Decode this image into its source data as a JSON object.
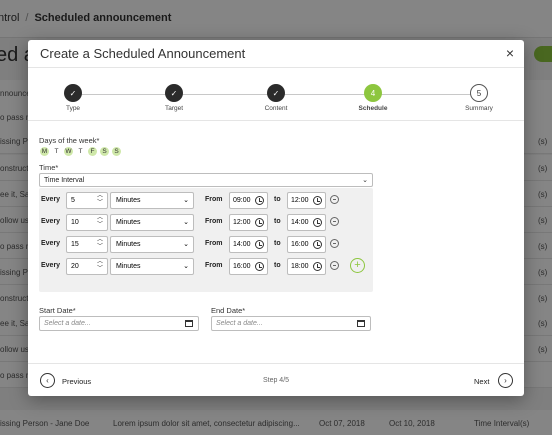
{
  "background": {
    "breadcrumb": [
      "ntrol",
      "/",
      "Scheduled announcement"
    ],
    "title": "ed a",
    "rows": [
      {
        "a": "nnounce",
        "b": "",
        "c": "",
        "d": "",
        "e": ""
      },
      {
        "a": "o pass m",
        "b": "",
        "c": "",
        "d": "",
        "e": ""
      },
      {
        "a": "issing Pe",
        "b": "",
        "c": "",
        "d": "",
        "e": "(s)"
      },
      {
        "a": "onstructi",
        "b": "",
        "c": "",
        "d": "",
        "e": "(s)"
      },
      {
        "a": "ee it, Say",
        "b": "",
        "c": "",
        "d": "",
        "e": "(s)"
      },
      {
        "a": "ollow us",
        "b": "",
        "c": "",
        "d": "",
        "e": "(s)"
      },
      {
        "a": "o pass m",
        "b": "",
        "c": "",
        "d": "",
        "e": "(s)"
      },
      {
        "a": "issing Pe",
        "b": "",
        "c": "",
        "d": "",
        "e": "(s)"
      },
      {
        "a": "onstructi",
        "b": "",
        "c": "",
        "d": "",
        "e": "(s)"
      },
      {
        "a": "ee it, Say",
        "b": "",
        "c": "",
        "d": "",
        "e": "(s)"
      },
      {
        "a": "ollow us",
        "b": "",
        "c": "",
        "d": "",
        "e": "(s)"
      },
      {
        "a": "o pass m",
        "b": "",
        "c": "",
        "d": "",
        "e": ""
      },
      {
        "a": "issing Person - Jane Doe",
        "b": "Lorem ipsum dolor sit amet, consectetur adipiscing...",
        "c": "Oct 07, 2018",
        "d": "Oct 10, 2018",
        "e": "Time Interval(s)"
      }
    ]
  },
  "modal": {
    "title": "Create a Scheduled Announcement",
    "close": "×",
    "steps": [
      {
        "label": "Type",
        "state": "done",
        "mark": "✓"
      },
      {
        "label": "Target",
        "state": "done",
        "mark": "✓"
      },
      {
        "label": "Content",
        "state": "done",
        "mark": "✓"
      },
      {
        "label": "Schedule",
        "state": "active",
        "mark": "4"
      },
      {
        "label": "Summary",
        "state": "todo",
        "mark": "5"
      }
    ],
    "days_label": "Days of the week*",
    "days": [
      {
        "letter": "M",
        "on": true
      },
      {
        "letter": "T",
        "on": false
      },
      {
        "letter": "W",
        "on": true
      },
      {
        "letter": "T",
        "on": false
      },
      {
        "letter": "F",
        "on": true
      },
      {
        "letter": "S",
        "on": true
      },
      {
        "letter": "S",
        "on": true
      }
    ],
    "time_label": "Time*",
    "time_mode": "Time Interval",
    "every_label": "Every",
    "from_label": "From",
    "to_label": "to",
    "intervals": [
      {
        "every": "5",
        "unit": "Minutes",
        "from": "09:00",
        "to": "12:00"
      },
      {
        "every": "10",
        "unit": "Minutes",
        "from": "12:00",
        "to": "14:00"
      },
      {
        "every": "15",
        "unit": "Minutes",
        "from": "14:00",
        "to": "16:00"
      },
      {
        "every": "20",
        "unit": "Minutes",
        "from": "16:00",
        "to": "18:00"
      }
    ],
    "start_label": "Start Date*",
    "end_label": "End Date*",
    "date_placeholder": "Select a date...",
    "prev_label": "Previous",
    "next_label": "Next",
    "step_indicator": "Step 4/5"
  }
}
